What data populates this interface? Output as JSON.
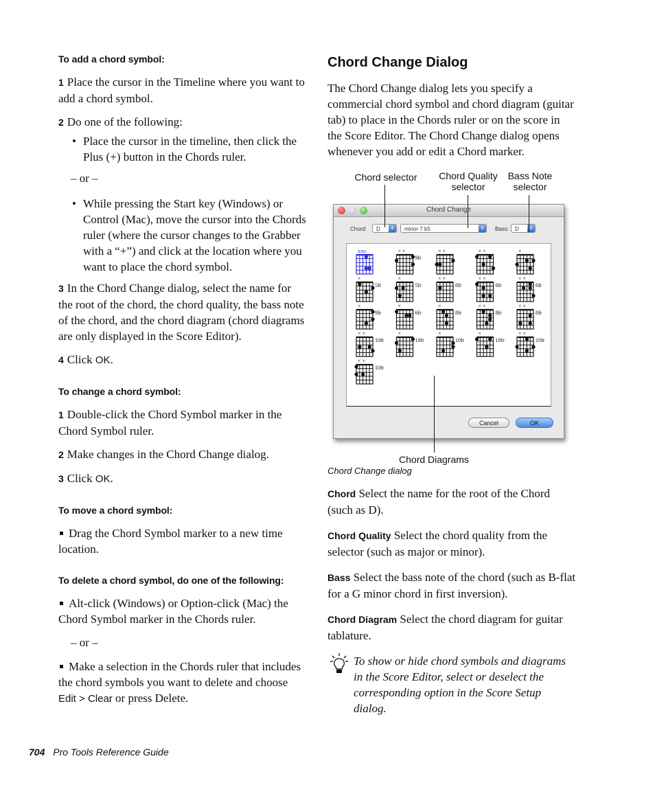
{
  "left": {
    "add": {
      "heading": "To add a chord symbol:",
      "steps": [
        {
          "num": "1",
          "text": "Place the cursor in the Timeline where you want to add a chord symbol."
        },
        {
          "num": "2",
          "text": "Do one of the following:"
        }
      ],
      "bullet1": "Place the cursor in the timeline, then click the Plus (+) button in the Chords ruler.",
      "or": "– or –",
      "bullet2": "While pressing the Start key (Windows) or Control (Mac), move the cursor into the Chords ruler (where the cursor changes to the Grabber with a “+”) and click at the location where you want to place the chord symbol.",
      "step3_num": "3",
      "step3": "In the Chord Change dialog, select the name for the root of the chord, the chord quality, the bass note of the chord, and the chord diagram (chord diagrams are only displayed in the Score Editor).",
      "step4_num": "4",
      "step4_pre": "Click ",
      "step4_ok": "OK",
      "step4_post": "."
    },
    "change": {
      "heading": "To change a chord symbol:",
      "step1_num": "1",
      "step1": "Double-click the Chord Symbol marker in the Chord Symbol ruler.",
      "step2_num": "2",
      "step2": "Make changes in the Chord Change dialog.",
      "step3_num": "3",
      "step3_pre": "Click ",
      "step3_ok": "OK",
      "step3_post": "."
    },
    "move": {
      "heading": "To move a chord symbol:",
      "item": "Drag the Chord Symbol marker to a new time location."
    },
    "delete": {
      "heading": "To delete a chord symbol, do one of the following:",
      "item1": "Alt-click (Windows) or Option-click (Mac) the Chord Symbol marker in the Chords ruler.",
      "or": "– or –",
      "item2_pre": "Make a selection in the Chords ruler that includes the chord symbols you want to delete and choose ",
      "item2_menu": "Edit > Clear",
      "item2_post": " or press Delete."
    }
  },
  "right": {
    "section_title": "Chord Change Dialog",
    "intro": "The Chord Change dialog lets you specify a commercial chord symbol and chord diagram (guitar tab) to place in the Chords ruler or on the score in the Score Editor. The Chord Change dialog opens whenever you add or edit a Chord marker.",
    "callouts": {
      "chord_selector": "Chord selector",
      "quality_selector": "Chord Quality selector",
      "bass_selector": "Bass Note selector",
      "diagrams": "Chord Diagrams"
    },
    "dialog": {
      "title": "Chord Change",
      "chord_label": "Chord:",
      "chord_value": "D",
      "quality_value": "minor 7 b5",
      "bass_label": "Bass:",
      "bass_value": "D",
      "cancel_label": "Cancel",
      "ok_label": "OK",
      "diagram_frets": [
        "",
        "9fr",
        "",
        "",
        "",
        "5fr",
        "5fr",
        "8fr",
        "6fr",
        "6fr",
        "9fr",
        "6fr",
        "8fr",
        "8fr",
        "8fr",
        "10fr",
        "10fr",
        "10fr",
        "10fr",
        "10fr",
        "10fr"
      ],
      "selected_diagram": 0,
      "accent_color": "#2a2ad6"
    },
    "caption": "Chord Change dialog",
    "defs": [
      {
        "term": "Chord",
        "text": "Select the name for the root of the Chord (such as D)."
      },
      {
        "term": "Chord Quality",
        "text": "Select the chord quality from the selector (such as major or minor)."
      },
      {
        "term": "Bass",
        "text": "Select the bass note of the chord (such as B-flat for a G minor chord in first inversion)."
      },
      {
        "term": "Chord Diagram",
        "text": "Select the chord diagram for guitar tablature."
      }
    ],
    "tip": "To show or hide chord symbols and diagrams in the Score Editor, select or deselect the corresponding option in the Score Setup dialog."
  },
  "footer": {
    "page_number": "704",
    "guide_title": "Pro Tools Reference Guide"
  }
}
